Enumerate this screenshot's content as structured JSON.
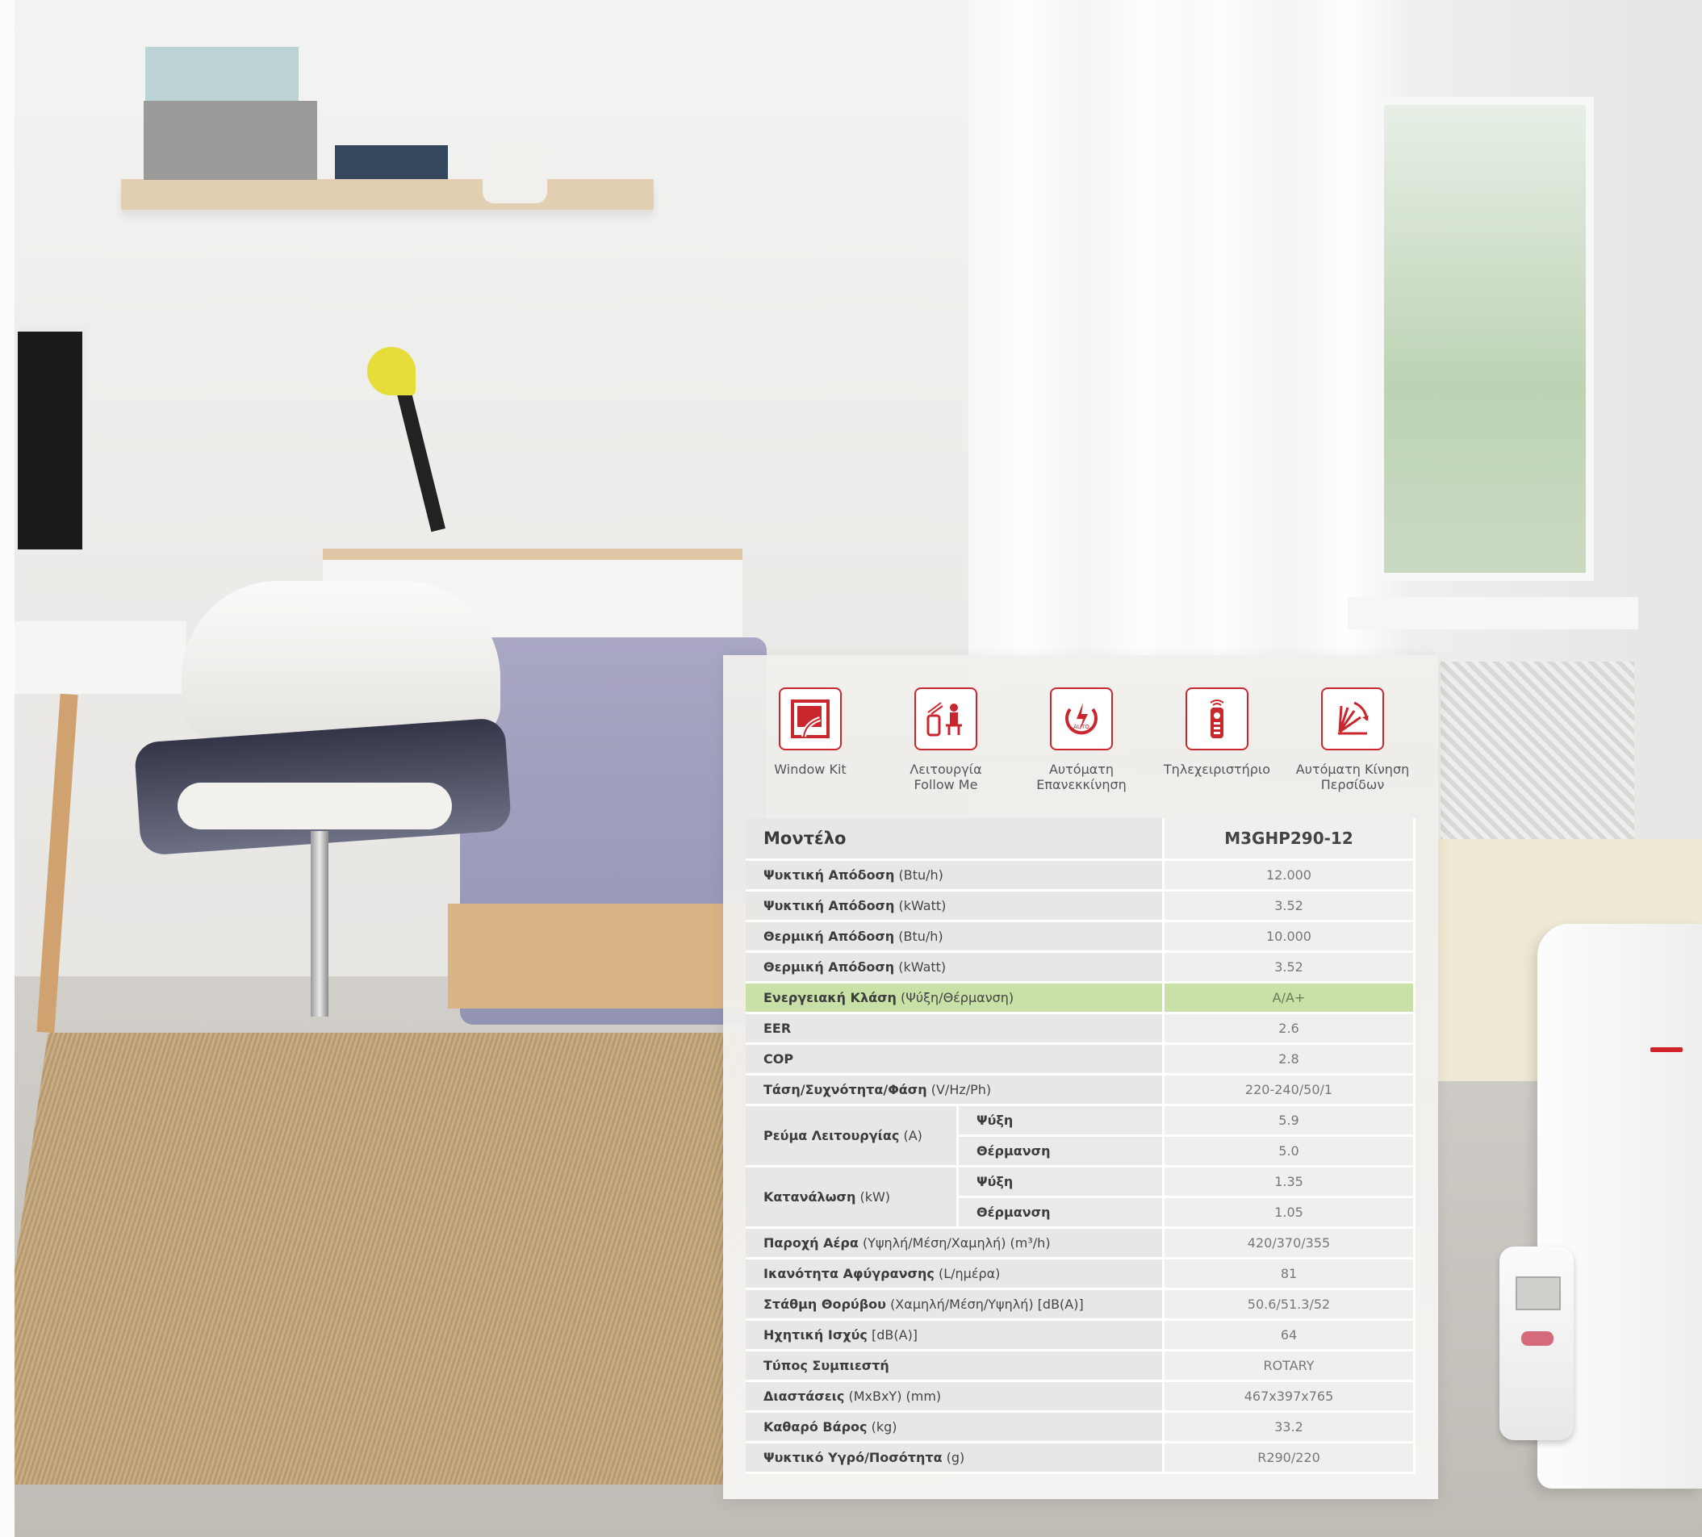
{
  "features": [
    {
      "icon": "window-kit-icon",
      "label": "Window Kit"
    },
    {
      "icon": "follow-me-icon",
      "label": "Λειτουργία\nFollow Me"
    },
    {
      "icon": "auto-restart-icon",
      "label": "Αυτόματη\nΕπανεκκίνηση"
    },
    {
      "icon": "remote-control-icon",
      "label": "Τηλεχειριστήριο"
    },
    {
      "icon": "auto-swing-icon",
      "label": "Αυτόματη Κίνηση\nΠερσίδων"
    }
  ],
  "table": {
    "header": {
      "label": "Μοντέλο",
      "value": "M3GHP290-12"
    },
    "rows": [
      {
        "label": "Ψυκτική Απόδοση",
        "unit": "(Btu/h)",
        "value": "12.000"
      },
      {
        "label": "Ψυκτική Απόδοση",
        "unit": "(kWatt)",
        "value": "3.52"
      },
      {
        "label": "Θερμική Απόδοση",
        "unit": "(Btu/h)",
        "value": "10.000"
      },
      {
        "label": "Θερμική Απόδοση",
        "unit": "(kWatt)",
        "value": "3.52"
      },
      {
        "label": "Ενεργειακή Κλάση",
        "unit": "(Ψύξη/Θέρμανση)",
        "value": "A/A+"
      },
      {
        "label": "EER",
        "unit": "",
        "value": "2.6"
      },
      {
        "label": "COP",
        "unit": "",
        "value": "2.8"
      },
      {
        "label": "Τάση/Συχνότητα/Φάση",
        "unit": "(V/Hz/Ph)",
        "value": "220-240/50/1"
      }
    ],
    "current": {
      "label": "Ρεύμα Λειτουργίας",
      "unit": "(A)",
      "cooling_label": "Ψύξη",
      "cooling_value": "5.9",
      "heating_label": "Θέρμανση",
      "heating_value": "5.0"
    },
    "power": {
      "label": "Κατανάλωση",
      "unit": "(kW)",
      "cooling_label": "Ψύξη",
      "cooling_value": "1.35",
      "heating_label": "Θέρμανση",
      "heating_value": "1.05"
    },
    "rows2": [
      {
        "label": "Παροχή Αέρα",
        "unit": "(Υψηλή/Μέση/Χαμηλή) (m³/h)",
        "value": "420/370/355"
      },
      {
        "label": "Ικανότητα Αφύγρανσης",
        "unit": "(L/ημέρα)",
        "value": "81"
      },
      {
        "label": "Στάθμη Θορύβου",
        "unit": "(Χαμηλή/Μέση/Υψηλή) [dB(A)]",
        "value": "50.6/51.3/52"
      },
      {
        "label": "Ηχητική Ισχύς",
        "unit": "[dB(A)]",
        "value": "64"
      },
      {
        "label": "Τύπος Συμπιεστή",
        "unit": "",
        "value": "ROTARY"
      },
      {
        "label": "Διαστάσεις",
        "unit": "(ΜxΒxΥ) (mm)",
        "value": "467x397x765"
      },
      {
        "label": "Καθαρό Βάρος",
        "unit": "(kg)",
        "value": "33.2"
      },
      {
        "label": "Ψυκτικό Υγρό/Ποσότητα",
        "unit": "(g)",
        "value": "R290/220"
      }
    ]
  },
  "colors": {
    "accent": "#c9262d",
    "highlight_row": "#c9e1a7"
  }
}
